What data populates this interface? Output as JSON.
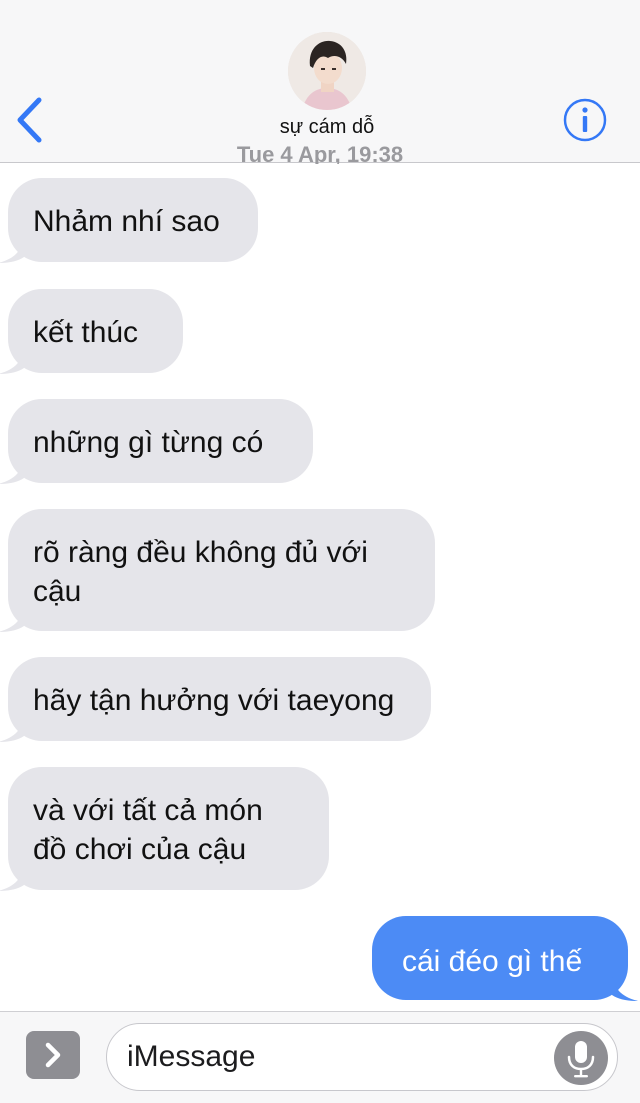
{
  "header": {
    "contact_name": "sự cám dỗ",
    "timestamp_partial": "Tue 4 Apr, 19:38"
  },
  "messages": [
    {
      "direction": "incoming",
      "text": "Nhảm nhí sao"
    },
    {
      "direction": "incoming",
      "text": "kết thúc"
    },
    {
      "direction": "incoming",
      "text": "những gì từng có"
    },
    {
      "direction": "incoming",
      "lines": [
        "rõ ràng đều không đủ với",
        "cậu"
      ]
    },
    {
      "direction": "incoming",
      "text": "hãy tận hưởng với taeyong"
    },
    {
      "direction": "incoming",
      "lines": [
        "và với tất cả món",
        "đồ chơi của cậu"
      ]
    },
    {
      "direction": "outgoing",
      "text": "cái đéo gì thế"
    }
  ],
  "input": {
    "placeholder": "iMessage"
  },
  "icons": {
    "back": "chevron-left-icon",
    "info": "info-icon",
    "expand": "chevron-right-icon",
    "mic": "microphone-icon"
  },
  "colors": {
    "accent": "#3478f6",
    "incoming_bubble": "#e5e5ea",
    "outgoing_bubble": "#4c8bf5",
    "bar_background": "#f7f7f8"
  }
}
